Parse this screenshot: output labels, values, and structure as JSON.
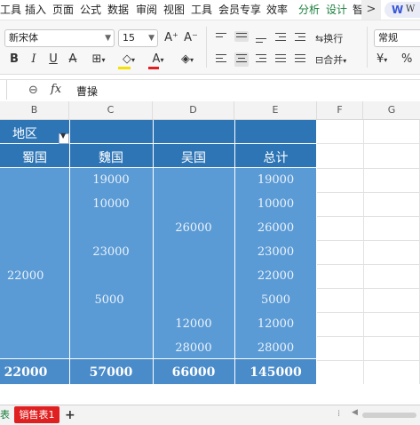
{
  "menu": {
    "items": [
      {
        "label": "工具",
        "accent": false
      },
      {
        "label": "插入",
        "accent": false
      },
      {
        "label": "页面",
        "accent": false
      },
      {
        "label": "公式",
        "accent": false
      },
      {
        "label": "数据",
        "accent": false
      },
      {
        "label": "审阅",
        "accent": false
      },
      {
        "label": "视图",
        "accent": false
      },
      {
        "label": "工具",
        "accent": false
      },
      {
        "label": "会员专享",
        "accent": false
      },
      {
        "label": "效率",
        "accent": false
      },
      {
        "label": "分析",
        "accent": true
      },
      {
        "label": "设计",
        "accent": true
      },
      {
        "label": "智",
        "accent": false
      }
    ],
    "more_label": ">",
    "badge_logo": "W",
    "badge_text": "W"
  },
  "ribbon": {
    "font_name": "新宋体",
    "font_size": "15",
    "grow_label": "A⁺",
    "shrink_label": "A⁻",
    "bold": "B",
    "italic": "I",
    "underline": "U",
    "strike": "A",
    "wrap_label": "换行",
    "merge_label": "合并",
    "number_format": "常规",
    "currency": "¥",
    "percent": "%",
    "accent_color": "#e02020",
    "fill_color": "#f5e100"
  },
  "formula_bar": {
    "fx": "fx",
    "value": "曹操"
  },
  "columns": [
    "B",
    "C",
    "D",
    "E",
    "F",
    "G"
  ],
  "table": {
    "filter_label": "地区",
    "headers": [
      "蜀国",
      "魏国",
      "吴国",
      "总计"
    ],
    "values": {
      "shu": [
        "22000"
      ],
      "wei": [
        "19000",
        "10000",
        "23000",
        "5000"
      ],
      "wu": [
        "26000",
        "12000",
        "28000"
      ],
      "total": [
        "19000",
        "10000",
        "26000",
        "23000",
        "22000",
        "5000",
        "12000",
        "28000"
      ]
    },
    "totals": [
      "22000",
      "57000",
      "66000",
      "145000"
    ],
    "body_color": "#5b9bd5",
    "header_color": "#2e75b6"
  },
  "sheets": {
    "prev_tab": "表",
    "active_tab": "销售表1",
    "add_label": "+"
  }
}
